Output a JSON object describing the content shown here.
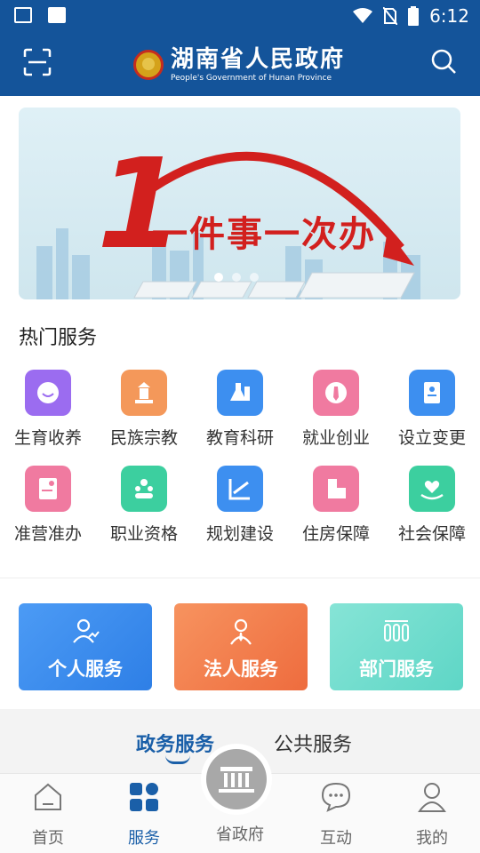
{
  "status_bar": {
    "time": "6:12"
  },
  "header": {
    "title": "湖南省人民政府",
    "subtitle": "People's Government of Hunan Province"
  },
  "banner": {
    "headline": "一件事一次办",
    "numeral": "1"
  },
  "section": {
    "title": "热门服务"
  },
  "services": [
    {
      "label": "生育收养",
      "icon": "baby-icon",
      "color": "#9b6cf0"
    },
    {
      "label": "民族宗教",
      "icon": "temple-icon",
      "color": "#f4985a"
    },
    {
      "label": "教育科研",
      "icon": "flask-icon",
      "color": "#3d8ff0"
    },
    {
      "label": "就业创业",
      "icon": "tie-icon",
      "color": "#f07aa0"
    },
    {
      "label": "设立变更",
      "icon": "id-card-icon",
      "color": "#3d8ff0"
    },
    {
      "label": "准营准办",
      "icon": "certificate-icon",
      "color": "#f07aa0"
    },
    {
      "label": "职业资格",
      "icon": "people-icon",
      "color": "#3ccf9f"
    },
    {
      "label": "规划建设",
      "icon": "ruler-icon",
      "color": "#3d8ff0"
    },
    {
      "label": "住房保障",
      "icon": "building-icon",
      "color": "#f07aa0"
    },
    {
      "label": "社会保障",
      "icon": "heart-hand-icon",
      "color": "#3ccf9f"
    }
  ],
  "cards": [
    {
      "label": "个人服务",
      "icon": "person-chart-icon",
      "color": "#3b8ff0"
    },
    {
      "label": "法人服务",
      "icon": "person-tie-icon",
      "color": "#f07a45"
    },
    {
      "label": "部门服务",
      "icon": "columns-icon",
      "color": "#6fdccd"
    }
  ],
  "tabs": {
    "gov": "政务服务",
    "public": "公共服务"
  },
  "nav": [
    {
      "label": "首页",
      "icon": "home-icon"
    },
    {
      "label": "服务",
      "icon": "grid-icon"
    },
    {
      "label": "省政府",
      "icon": "government-icon"
    },
    {
      "label": "互动",
      "icon": "chat-icon"
    },
    {
      "label": "我的",
      "icon": "user-icon"
    }
  ]
}
